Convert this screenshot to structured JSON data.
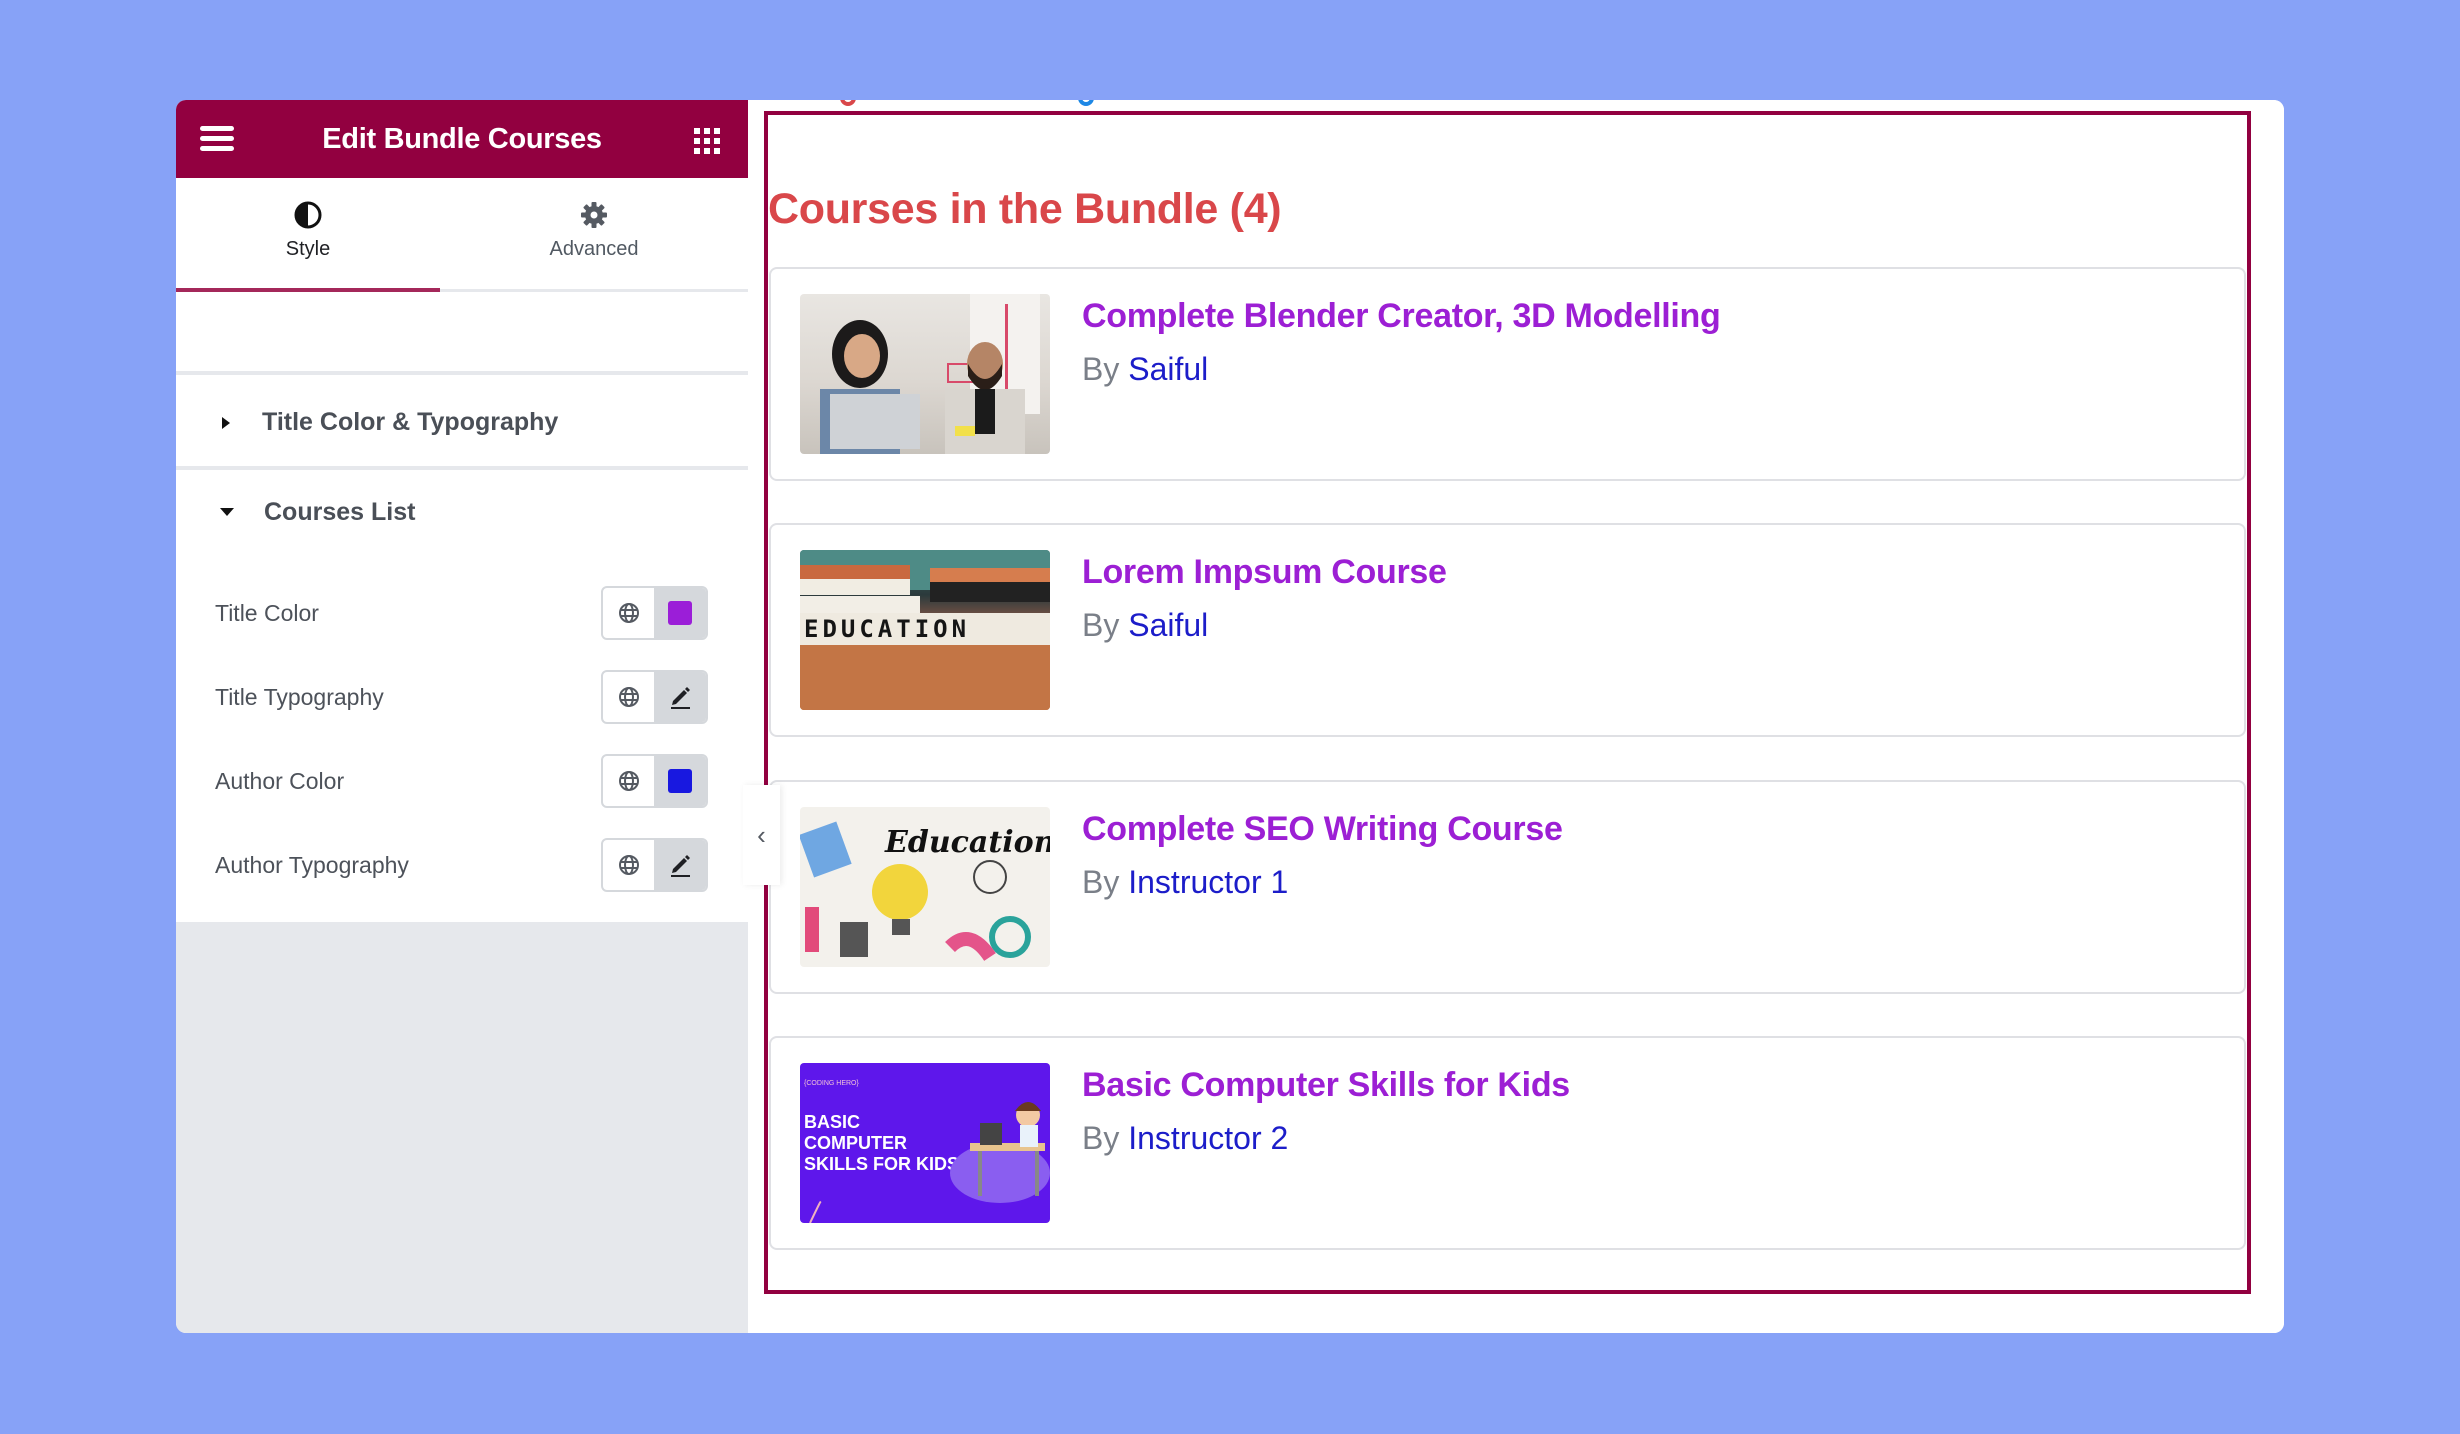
{
  "editor": {
    "title": "Edit Bundle Courses",
    "icons": {
      "menu": "hamburger-icon",
      "widgets": "grid-icon"
    },
    "tabs": [
      {
        "label": "Style",
        "icon": "contrast-icon",
        "active": true
      },
      {
        "label": "Advanced",
        "icon": "gear-icon",
        "active": false
      }
    ],
    "sections": [
      {
        "label": "Title Color & Typography",
        "expanded": false
      },
      {
        "label": "Courses List",
        "expanded": true
      }
    ],
    "controls": [
      {
        "label": "Title Color",
        "type": "color",
        "value": "#9b1ed8"
      },
      {
        "label": "Title Typography",
        "type": "typography",
        "icon": "pencil-icon"
      },
      {
        "label": "Author Color",
        "type": "color",
        "value": "#1818e0"
      },
      {
        "label": "Author Typography",
        "type": "typography",
        "icon": "pencil-icon"
      }
    ],
    "collapse_icon": "‹"
  },
  "preview": {
    "bundle_title": "Courses in the Bundle (4)",
    "by_label": "By",
    "courses": [
      {
        "title": "Complete Blender Creator, 3D Modelling",
        "author": "Saiful"
      },
      {
        "title": "Lorem Impsum Course",
        "author": "Saiful",
        "thumb_text": "EDUCATION"
      },
      {
        "title": "Complete SEO Writing Course",
        "author": "Instructor 1",
        "thumb_text": "Education"
      },
      {
        "title": "Basic Computer Skills for Kids",
        "author": "Instructor 2",
        "thumb_text": "BASIC COMPUTER SKILLS FOR KIDS",
        "thumb_tag": "{CODING HERO}"
      }
    ]
  },
  "colors": {
    "brand": "#920040",
    "heading": "#d9474a",
    "course_title": "#9c1fd4",
    "author": "#1c1dc9",
    "background": "#87a2f7"
  }
}
